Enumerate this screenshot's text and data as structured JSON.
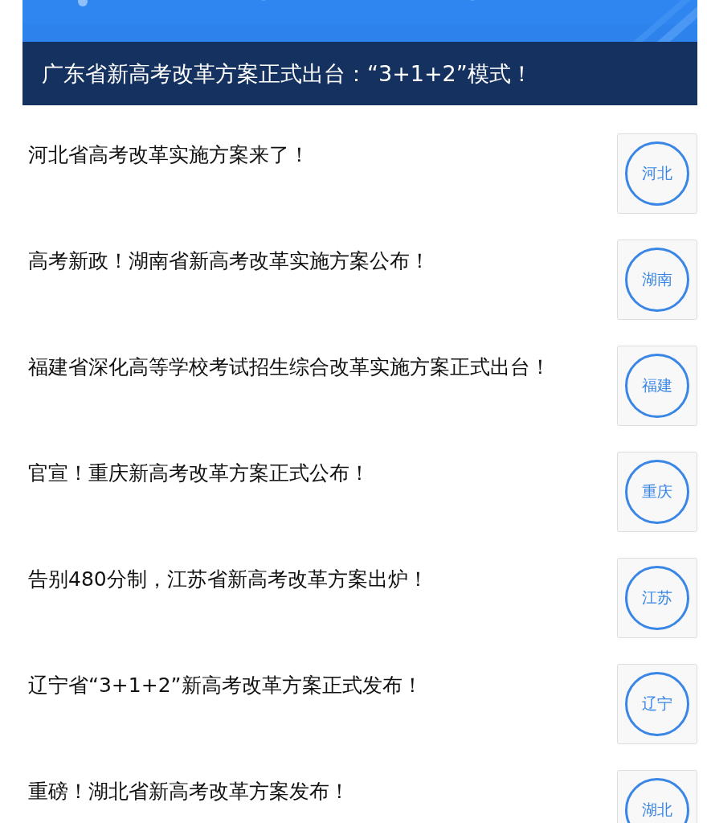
{
  "banner": {
    "kind": "picture",
    "caption": "广东省新高考改革方案正式出台：“3+1+2”模式！"
  },
  "articles": [
    {
      "title": "河北省高考改革实施方案来了！",
      "thumb": "河北"
    },
    {
      "title": "高考新政！湖南省新高考改革实施方案公布！",
      "thumb": "湖南"
    },
    {
      "title": "福建省深化高等学校考试招生综合改革实施方案正式出台！",
      "thumb": "福建"
    },
    {
      "title": "官宣！重庆新高考改革方案正式公布！",
      "thumb": "重庆"
    },
    {
      "title": "告别480分制，江苏省新高考改革方案出炉！",
      "thumb": "江苏"
    },
    {
      "title": "辽宁省“3+1+2”新高考改革方案正式发布！",
      "thumb": "辽宁"
    },
    {
      "title": "重磅！湖北省新高考改革方案发布！",
      "thumb": "湖北"
    }
  ]
}
